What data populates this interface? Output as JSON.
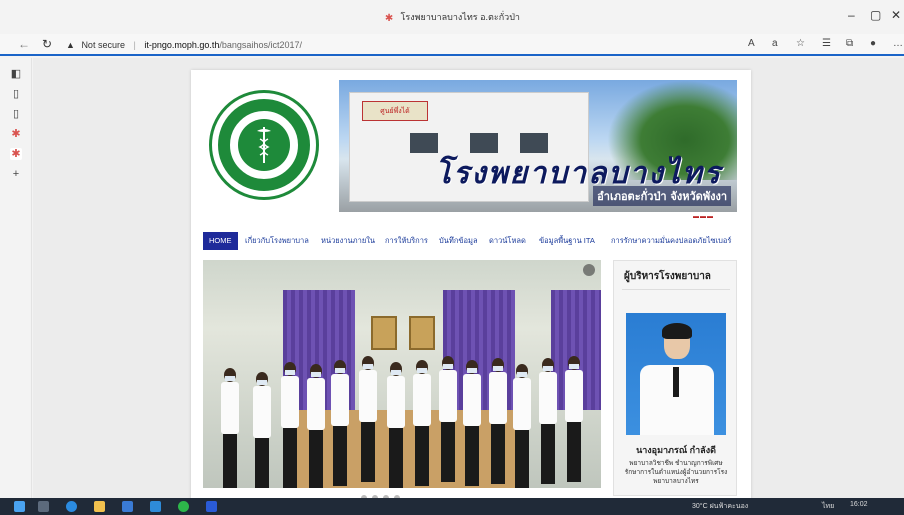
{
  "browser": {
    "tab_title": "โรงพยาบาลบางไทร อ.ตะกั่วป่า",
    "address": {
      "security": "Not secure",
      "host": "it-pngo.moph.go.th",
      "path": "/bangsaihos/ict2017/"
    },
    "window_controls": [
      "–",
      "▢",
      "✕"
    ]
  },
  "site": {
    "banner_title": "โรงพยาบาลบางไทร",
    "banner_subtitle": "อำเภอตะกั่วป่า จังหวัดพังงา",
    "banner_sign": "ศูนย์พึ่งได้",
    "menu": [
      {
        "label": "HOME",
        "active": true
      },
      {
        "label": "เกี่ยวกับโรงพยาบาล",
        "active": false
      },
      {
        "label": "หน่วยงานภายใน",
        "active": false
      },
      {
        "label": "การให้บริการ",
        "active": false
      },
      {
        "label": "บันทึกข้อมูล",
        "active": false
      },
      {
        "label": "ดาวน์โหลด",
        "active": false
      },
      {
        "label": "ข้อมูลพื้นฐาน ITA",
        "active": false
      },
      {
        "label": "การรักษาความมั่นคงปลอดภัยไซเบอร์",
        "active": false
      }
    ],
    "sidebar": {
      "heading": "ผู้บริหารโรงพยาบาล",
      "director_name": "นางอุมาภรณ์ กำลังดี",
      "director_role": "พยาบาลวิชาชีพ ชำนาญการพิเศษ รักษาการในตำแหน่งผู้อำนวยการโรงพยาบาลบางไทร"
    }
  },
  "taskbar": {
    "weather": "30°C ฝนฟ้าคะนอง",
    "language": "ไทย",
    "time": "16:02"
  },
  "colors": {
    "accent": "#1a64c8",
    "menu_active": "#1e2a9a",
    "menu_text": "#1a3a9a",
    "moph_green": "#1e8a3a"
  }
}
